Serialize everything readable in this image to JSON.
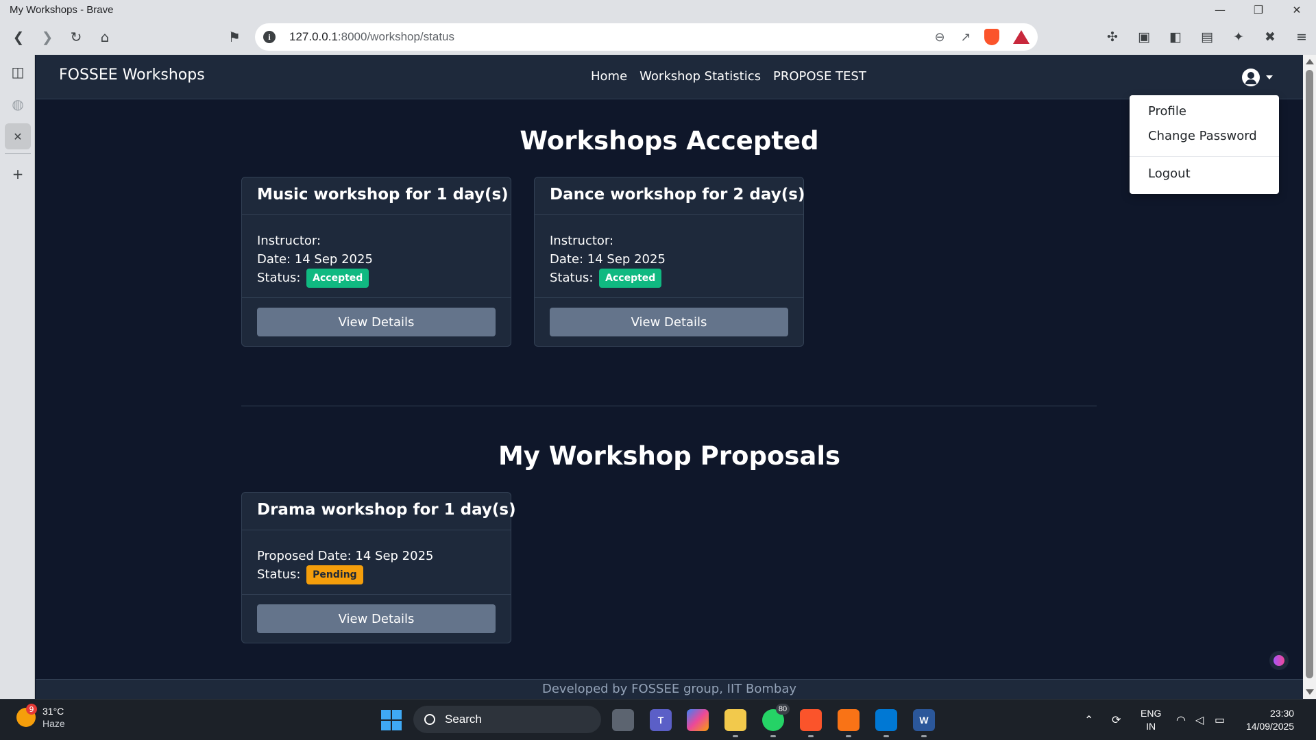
{
  "window": {
    "title": "My Workshops - Brave",
    "controls": {
      "minimize": "—",
      "restore": "❐",
      "close": "✕"
    }
  },
  "toolbar": {
    "url_host": "127.0.0.1",
    "url_path": ":8000/workshop/status",
    "icons": [
      "back-icon",
      "forward-icon",
      "reload-icon",
      "home-icon",
      "bookmark-icon",
      "site-info-icon",
      "zoom-icon",
      "share-icon",
      "brave-shields-icon",
      "brave-rewards-icon",
      "extensions-icon",
      "reader-icon",
      "sidebar-icon",
      "wallet-icon",
      "leo-ai-icon",
      "vpn-icon",
      "menu-icon"
    ]
  },
  "navbar": {
    "brand": "FOSSEE Workshops",
    "links": [
      "Home",
      "Workshop Statistics",
      "PROPOSE TEST"
    ]
  },
  "user_menu": {
    "items": [
      "Profile",
      "Change Password",
      "Logout"
    ]
  },
  "accepted_section": {
    "heading": "Workshops Accepted",
    "cards": [
      {
        "title": "Music workshop for 1 day(s)",
        "instructor_label": "Instructor:",
        "date": "Date: 14 Sep 2025",
        "status_label": "Status:",
        "status": "Accepted",
        "button": "View Details"
      },
      {
        "title": "Dance workshop for 2 day(s)",
        "instructor_label": "Instructor:",
        "date": "Date: 14 Sep 2025",
        "status_label": "Status:",
        "status": "Accepted",
        "button": "View Details"
      }
    ]
  },
  "proposals_section": {
    "heading": "My Workshop Proposals",
    "cards": [
      {
        "title": "Drama workshop for 1 day(s)",
        "date": "Proposed Date: 14 Sep 2025",
        "status_label": "Status:",
        "status": "Pending",
        "button": "View Details"
      }
    ]
  },
  "footer": {
    "text": "Developed by FOSSEE group, IIT Bombay"
  },
  "colors": {
    "page_bg": "#0f172a",
    "card_bg": "#1e293b",
    "accepted": "#10b981",
    "pending": "#f59e0b",
    "button": "#64748b"
  },
  "taskbar": {
    "weather": {
      "temp": "31°C",
      "condition": "Haze",
      "badge": "9"
    },
    "search_label": "Search",
    "whatsapp_badge": "80",
    "lang": {
      "line1": "ENG",
      "line2": "IN"
    },
    "clock": {
      "time": "23:30",
      "date": "14/09/2025"
    },
    "word_label": "W"
  }
}
